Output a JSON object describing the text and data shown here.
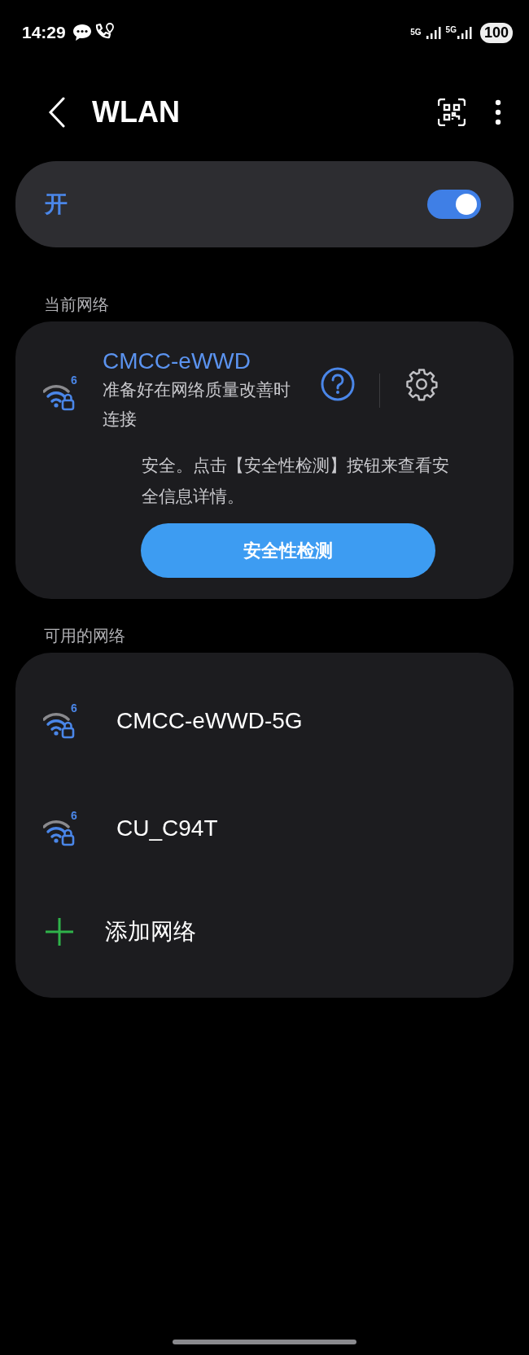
{
  "status_bar": {
    "time": "14:29",
    "network_1": "5G",
    "network_2": "5G",
    "battery": "100"
  },
  "header": {
    "title": "WLAN"
  },
  "wlan_switch": {
    "label": "开",
    "on": true
  },
  "current_section": {
    "title": "当前网络",
    "network": {
      "name": "CMCC-eWWD",
      "wifi_standard": "6",
      "status": "准备好在网络质量改善时连接",
      "security_note": "安全。点击【安全性检测】按钮来查看安全信息详情。",
      "button": "安全性检测"
    }
  },
  "available_section": {
    "title": "可用的网络",
    "networks": [
      {
        "name": "CMCC-eWWD-5G",
        "wifi_standard": "6"
      },
      {
        "name": "CU_C94T",
        "wifi_standard": "6"
      }
    ],
    "add_network": "添加网络"
  }
}
